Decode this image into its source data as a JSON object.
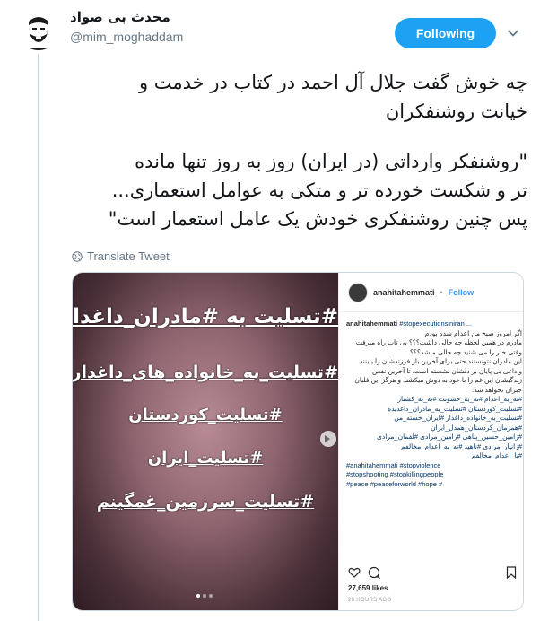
{
  "tweet": {
    "display_name": "محدث بی صواد",
    "username": "@mim_moghaddam",
    "follow_label": "Following",
    "text_lines": [
      "چه خوش گفت جلال آل احمد در کتاب در خدمت و",
      "خیانت روشنفکران",
      "\"روشنفکر وارداتی (در ایران) روز به روز تنها مانده",
      "تر و شکست خورده تر و متکی به عوامل استعماری...",
      "پس چنین روشنفکری خودش یک عامل استعمار است\""
    ],
    "translate_label": "Translate Tweet"
  },
  "media": {
    "image_hashtags": [
      "#تسلیت به #مادران_داغدار",
      "#تسلیت_به_خانواده_های_داغدار",
      "#تسلیت_کوردستان",
      "#تسلیت_ایران",
      "#تسلیت_سرزمین_غمگینم"
    ],
    "instagram": {
      "username": "anahitahemmati",
      "follow_label": "Follow",
      "caption_rows": [
        {
          "text": "anahitahemmati ",
          "tag": "#stopexecutionsiniran ...",
          "rtl": false,
          "bold": true
        },
        {
          "text": "اگر امروز صبح من اعدام شده بودم",
          "rtl": true
        },
        {
          "text": "مادرم در همین لحظه چه حالی داشت؟؟؟ بی تاب راه میرفت",
          "rtl": true
        },
        {
          "text": "وقتی خبر را می شنید چه حالی میشد؟؟؟",
          "rtl": true
        },
        {
          "text": "این مادران نتونستند حتی برای آخرین بار فرزندشان را ببینند",
          "rtl": true
        },
        {
          "text": "و داغی بی پایان بر دلشان نشسته است. تا آخرین نفس",
          "rtl": true
        },
        {
          "text": "زندگیشان این غم را با خود به دوش میکشند و هرگز این قلبان",
          "rtl": true
        },
        {
          "text": "جبران نخواهد شد.",
          "rtl": true
        },
        {
          "text": "#نه_به_اعدام #نه_به_خشونت #نه_به_کشتار",
          "rtl": true,
          "is_tag": true
        },
        {
          "text": "#تسلیت_کوردستان #تسلیت_به_مادران_داغدیده",
          "rtl": true,
          "is_tag": true
        },
        {
          "text": "#تسلیت_به_خانواده_داغدار #ایران_خسته_من",
          "rtl": true,
          "is_tag": true
        },
        {
          "text": "#همزمان_کردستان_همدل_ایران",
          "rtl": true,
          "is_tag": true
        },
        {
          "text": "#زامین_حسین_پناهی #رامین_مرادی #لقمان_مرادی",
          "rtl": true,
          "is_tag": true
        },
        {
          "text": "#زانیار_مرادی #ناهید #نه_به_اعدام_مخالفم",
          "rtl": true,
          "is_tag": true
        },
        {
          "text": "#با_اعدام_مخالفم",
          "rtl": true,
          "is_tag": true
        },
        {
          "text": "#anahitahemmati #stopviolence",
          "rtl": false,
          "is_tag": true
        },
        {
          "text": "#stopshooting #stopkillingpeople",
          "rtl": false,
          "is_tag": true
        },
        {
          "text": "#peace #peaceforworld #hope #",
          "rtl": false,
          "is_tag": true
        }
      ],
      "likes": "27,659 likes",
      "time": "20 HOURS AGO"
    }
  },
  "icons": {
    "avatar": "bearded-man-avatar-icon",
    "caret": "chevron-down-icon",
    "globe": "globe-icon",
    "heart": "heart-icon",
    "comment": "comment-icon",
    "bookmark": "bookmark-icon"
  },
  "colors": {
    "accent": "#1da1f2",
    "secondary_text": "#657786",
    "border": "#ccd6dd",
    "instagram_link": "#3897f0"
  }
}
